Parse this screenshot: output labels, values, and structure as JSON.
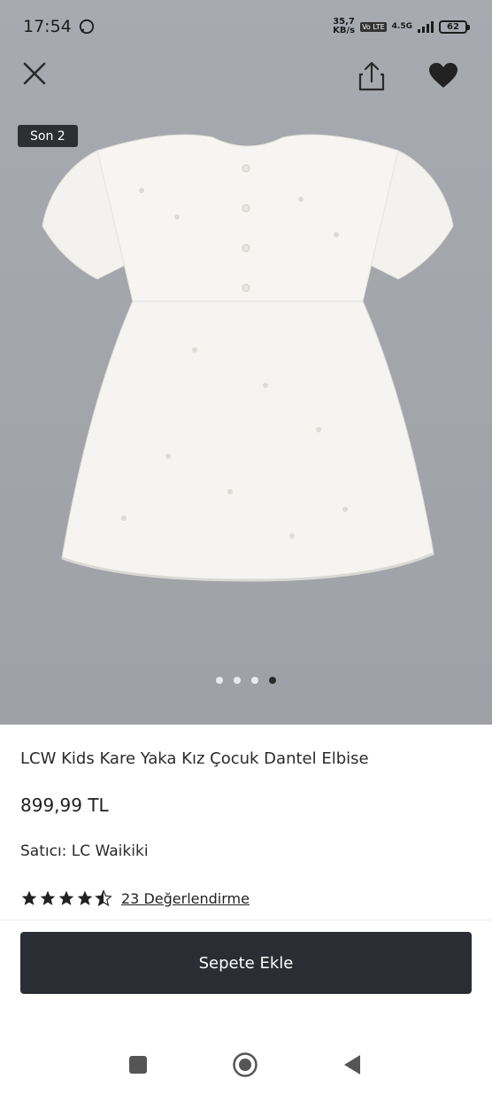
{
  "status": {
    "time": "17:54",
    "net_speed_value": "35,7",
    "net_speed_unit": "KB/s",
    "volte": "Vo LTE",
    "network": "4.5G",
    "battery": "62"
  },
  "gallery": {
    "badge": "Son 2",
    "image_count": 4,
    "active_index": 3
  },
  "product": {
    "title": "LCW Kids Kare Yaka Kız Çocuk Dantel Elbise",
    "price": "899,99 TL",
    "seller": "Satıcı: LC Waikiki",
    "rating": 4.5,
    "reviews": "23 Değerlendirme"
  },
  "cta": {
    "label": "Sepete Ekle"
  },
  "colors": {
    "cta_bg": "#2a2d33",
    "badge_bg": "#2d2f33",
    "gallery_bg": "#a3a7ac"
  },
  "icons": [
    "close-icon",
    "share-icon",
    "heart-icon",
    "star-icon",
    "square-icon",
    "home-circle-icon",
    "back-triangle-icon",
    "whatsapp-icon"
  ]
}
